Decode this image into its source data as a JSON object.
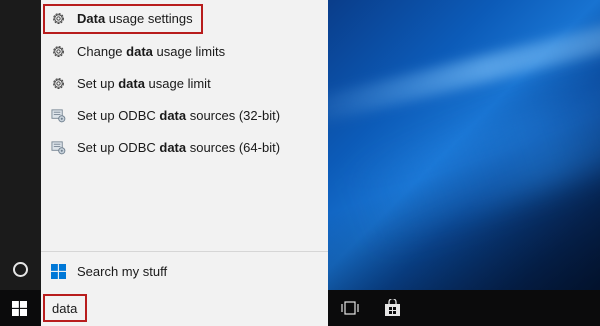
{
  "search": {
    "query": "data"
  },
  "results": [
    {
      "before": "",
      "bold": "Data",
      "after": " usage settings",
      "icon": "gear-icon",
      "highlighted": true
    },
    {
      "before": "Change ",
      "bold": "data",
      "after": " usage limits",
      "icon": "gear-icon",
      "highlighted": false
    },
    {
      "before": "Set up ",
      "bold": "data",
      "after": " usage limit",
      "icon": "gear-icon",
      "highlighted": false
    },
    {
      "before": "Set up ODBC ",
      "bold": "data",
      "after": " sources (32-bit)",
      "icon": "odbc-icon",
      "highlighted": false
    },
    {
      "before": "Set up ODBC ",
      "bold": "data",
      "after": " sources (64-bit)",
      "icon": "odbc-icon",
      "highlighted": false
    }
  ],
  "search_my_stuff": {
    "label": "Search my stuff",
    "icon": "windows-logo-icon"
  },
  "taskbar": {
    "icons": [
      "windows-start-icon",
      "task-view-icon",
      "store-icon"
    ]
  },
  "colors": {
    "highlight_border": "#b81d1d",
    "panel_bg": "#f2f2f2",
    "rail_bg": "#1b1b1b",
    "taskbar_bg": "#0b0b0c",
    "windows_blue": "#0078d7"
  }
}
